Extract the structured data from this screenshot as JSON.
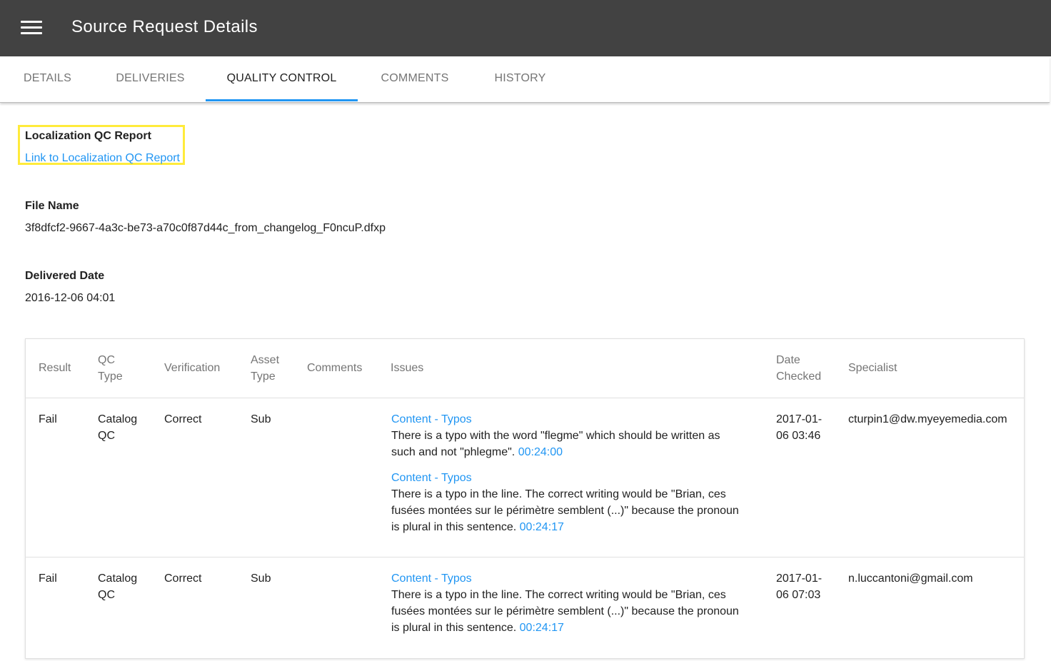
{
  "appbar": {
    "title": "Source Request Details"
  },
  "tabs": [
    {
      "label": "DETAILS"
    },
    {
      "label": "DELIVERIES"
    },
    {
      "label": "QUALITY CONTROL",
      "active": true
    },
    {
      "label": "COMMENTS"
    },
    {
      "label": "HISTORY"
    }
  ],
  "qc_report": {
    "label": "Localization QC Report",
    "link_text": "Link to Localization QC Report"
  },
  "file": {
    "label": "File Name",
    "value": "3f8dfcf2-9667-4a3c-be73-a70c0f87d44c_from_changelog_F0ncuP.dfxp"
  },
  "delivered": {
    "label": "Delivered Date",
    "value": "2016-12-06 04:01"
  },
  "table": {
    "headers": {
      "result": "Result",
      "qc_type_1": "QC",
      "qc_type_2": "Type",
      "verification": "Verification",
      "asset_type_1": "Asset",
      "asset_type_2": "Type",
      "comments": "Comments",
      "issues": "Issues",
      "date_checked_1": "Date",
      "date_checked_2": "Checked",
      "specialist": "Specialist"
    },
    "rows": [
      {
        "result": "Fail",
        "qc_type_1": "Catalog",
        "qc_type_2": "QC",
        "verification": "Correct",
        "asset_type": "Sub",
        "comments": "",
        "date_1": "2017-01-",
        "date_2": "06 03:46",
        "specialist": "cturpin1@dw.myeyemedia.com",
        "issues": [
          {
            "category": "Content - Typos",
            "line1": "There is a typo with the word \"flegme\" which should be written as",
            "line2": "such and not \"phlegme\".",
            "timecode": "00:24:00"
          },
          {
            "category": "Content - Typos",
            "line1": "There is a typo in the line. The correct writing would be \"Brian, ces",
            "line2": "fusées montées sur le périmètre semblent (...)\" because the pronoun",
            "line3": "is plural in this sentence.",
            "timecode": "00:24:17"
          }
        ]
      },
      {
        "result": "Fail",
        "qc_type_1": "Catalog",
        "qc_type_2": "QC",
        "verification": "Correct",
        "asset_type": "Sub",
        "comments": "",
        "date_1": "2017-01-",
        "date_2": "06 07:03",
        "specialist": "n.luccantoni@gmail.com",
        "issues": [
          {
            "category": "Content - Typos",
            "line1": "There is a typo in the line. The correct writing would be \"Brian, ces",
            "line2": "fusées montées sur le périmètre semblent (...)\" because the pronoun",
            "line3": "is plural in this sentence.",
            "timecode": "00:24:17"
          }
        ]
      }
    ]
  }
}
